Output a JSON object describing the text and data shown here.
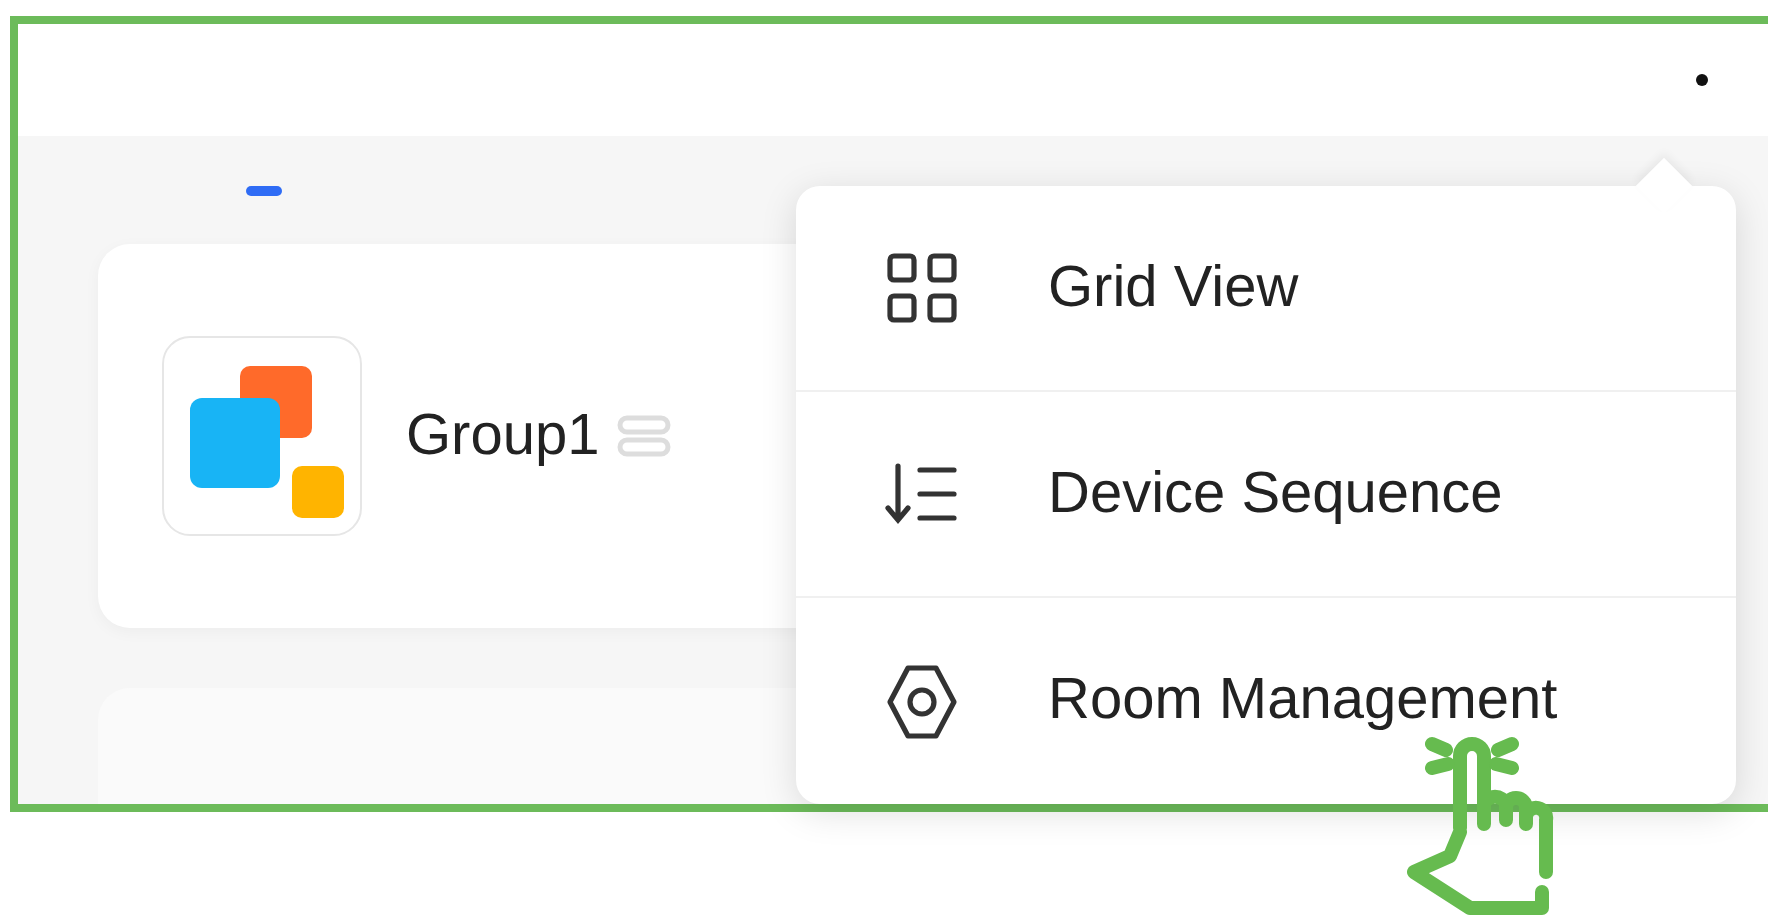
{
  "group_cards": [
    {
      "name": "Group1"
    }
  ],
  "menu": {
    "items": [
      {
        "kind": "grid",
        "label": "Grid View"
      },
      {
        "kind": "sequence",
        "label": "Device Sequence"
      },
      {
        "kind": "gear",
        "label": "Room Management"
      }
    ]
  }
}
